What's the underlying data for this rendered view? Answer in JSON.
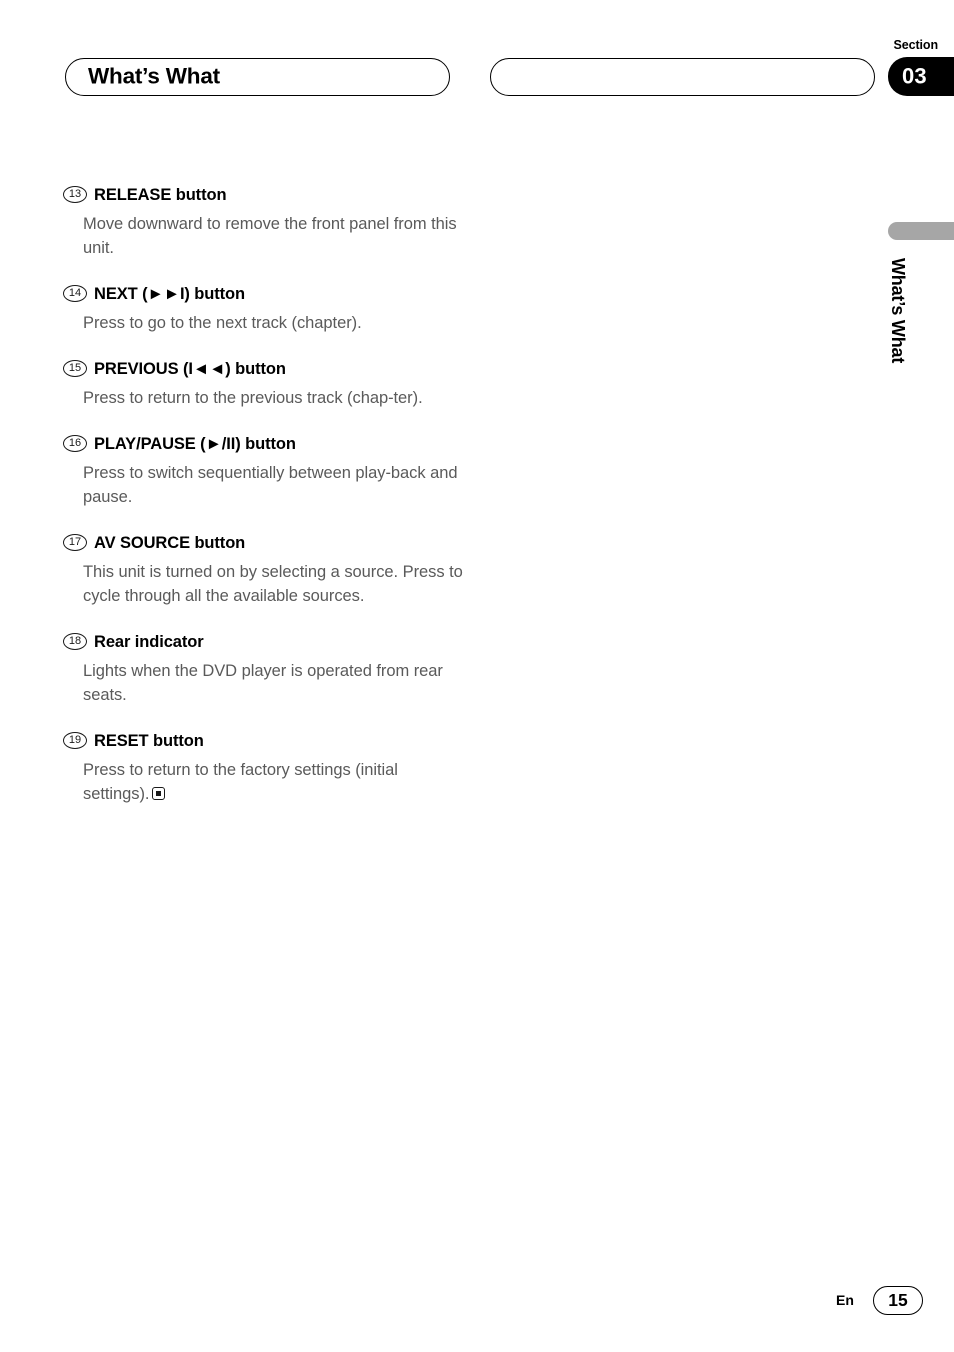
{
  "header": {
    "title": "What’s What",
    "section_label": "Section",
    "section_number": "03"
  },
  "side_tab": {
    "label": "What’s What"
  },
  "entries": [
    {
      "number": "13",
      "heading": "RELEASE button",
      "body": "Move downward to remove the front panel from this unit."
    },
    {
      "number": "14",
      "heading": "NEXT (►►I) button",
      "body": "Press to go to the next track (chapter)."
    },
    {
      "number": "15",
      "heading": "PREVIOUS (I◄◄) button",
      "body": "Press to return to the previous track (chap-ter)."
    },
    {
      "number": "16",
      "heading": "PLAY/PAUSE (►/II) button",
      "body": "Press to switch sequentially between play-back and pause."
    },
    {
      "number": "17",
      "heading": "AV SOURCE button",
      "body": "This unit is turned on by selecting a source. Press to cycle through all the available sources."
    },
    {
      "number": "18",
      "heading": "Rear indicator",
      "body": "Lights when the DVD player is operated from rear seats."
    },
    {
      "number": "19",
      "heading": "RESET button",
      "body": "Press to return to the factory settings (initial settings)."
    }
  ],
  "footer": {
    "language": "En",
    "page_number": "15"
  },
  "colors": {
    "badge_background": "#000000",
    "side_tab": "#a6a6a6",
    "body_text": "#5a5a5a"
  }
}
